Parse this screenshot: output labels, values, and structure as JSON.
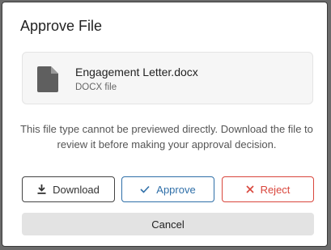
{
  "dialog": {
    "title": "Approve File"
  },
  "file": {
    "name": "Engagement Letter.docx",
    "type_label": "DOCX file",
    "icon": "document-icon"
  },
  "message": "This file type cannot be previewed directly. Download the file to review it before making your approval decision.",
  "buttons": {
    "download": {
      "label": "Download",
      "icon": "download-icon"
    },
    "approve": {
      "label": "Approve",
      "icon": "check-icon",
      "color": "#2f6fa8"
    },
    "reject": {
      "label": "Reject",
      "icon": "close-icon",
      "color": "#d9463c"
    },
    "cancel": {
      "label": "Cancel"
    }
  }
}
